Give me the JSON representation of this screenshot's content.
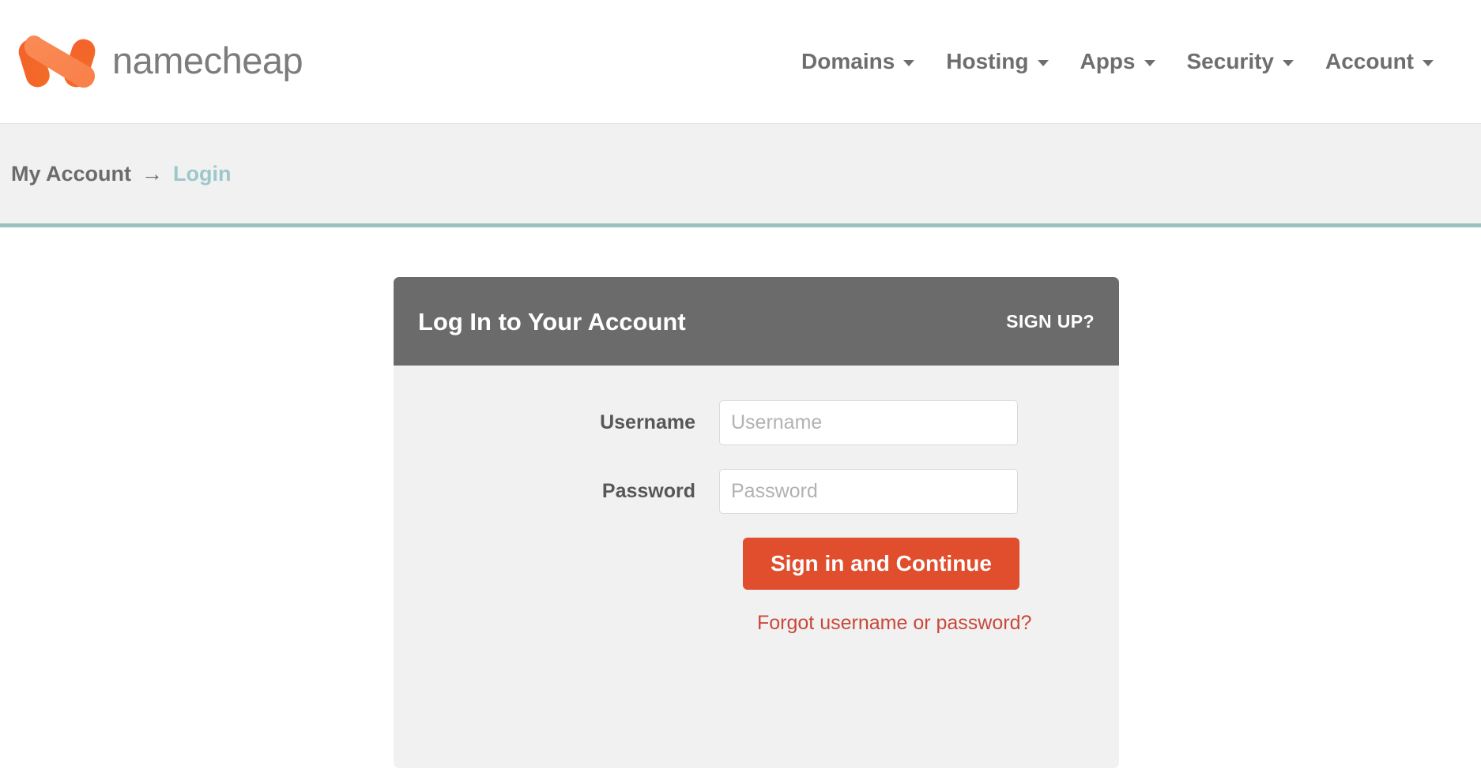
{
  "brand": {
    "name": "namecheap",
    "logo_icon": "namecheap-n-logo",
    "logo_color_dark": "#f05523",
    "logo_color_light": "#f8874f"
  },
  "nav": {
    "items": [
      {
        "label": "Domains",
        "caret_icon": "chevron-down-icon"
      },
      {
        "label": "Hosting",
        "caret_icon": "chevron-down-icon"
      },
      {
        "label": "Apps",
        "caret_icon": "chevron-down-icon"
      },
      {
        "label": "Security",
        "caret_icon": "chevron-down-icon"
      },
      {
        "label": "Account",
        "caret_icon": "chevron-down-icon"
      }
    ]
  },
  "breadcrumb": {
    "root": "My Account",
    "separator": "→",
    "current": "Login",
    "accent_color": "#9bc8c8"
  },
  "card": {
    "title": "Log In to Your Account",
    "signup_label": "SIGN UP?",
    "header_bg": "#6b6b6b",
    "body_bg": "#f1f1f1",
    "fields": [
      {
        "label": "Username",
        "placeholder": "Username",
        "value": "",
        "type": "text"
      },
      {
        "label": "Password",
        "placeholder": "Password",
        "value": "",
        "type": "password"
      }
    ],
    "submit_label": "Sign in and Continue",
    "submit_color": "#e04e2d",
    "forgot_label": "Forgot username or password?",
    "forgot_color": "#c9483a"
  }
}
